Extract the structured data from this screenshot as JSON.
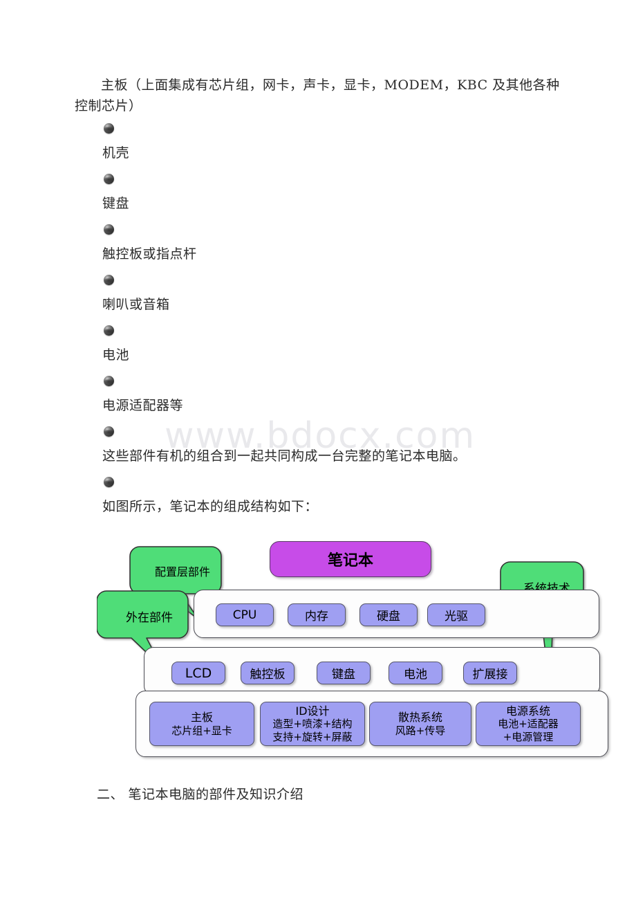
{
  "watermark": "www.bdocx.com",
  "document": {
    "intro_paragraph": "主板（上面集成有芯片组，网卡，声卡，显卡，MODEM，KBC 及其他各种控制芯片）",
    "bullet_items": [
      "机壳",
      "键盘",
      "触控板或指点杆",
      "喇叭或音箱",
      "电池",
      "电源适配器等",
      "这些部件有机的组合到一起共同构成一台完整的笔记本电脑。",
      "如图所示，笔记本的组成结构如下："
    ],
    "section_heading": "二、 笔记本电脑的部件及知识介绍"
  },
  "diagram": {
    "title_box": "笔记本",
    "callouts": [
      {
        "label": "配置层部件"
      },
      {
        "label": "外在部件"
      },
      {
        "label": "系统技术"
      }
    ],
    "rows": [
      {
        "name": "configuration-layer",
        "chips": [
          "CPU",
          "内存",
          "硬盘",
          "光驱"
        ]
      },
      {
        "name": "external-parts",
        "chips": [
          "LCD",
          "触控板",
          "键盘",
          "电池",
          "扩展接"
        ]
      }
    ],
    "system_row": [
      {
        "title": "主板",
        "lines": [
          "芯片组+显卡"
        ]
      },
      {
        "title": "ID设计",
        "lines": [
          "造型+喷漆+结构",
          "支持+旋转+屏蔽"
        ]
      },
      {
        "title": "散热系统",
        "lines": [
          "风路+传导"
        ]
      },
      {
        "title": "电源系统",
        "lines": [
          "电池+适配器",
          "+电源管理"
        ]
      }
    ]
  },
  "colors": {
    "title_purple": "#c74ce8",
    "chip_periwinkle": "#9f9ff2",
    "callout_green": "#4fdd78",
    "border_dark": "#4a4a52",
    "watermark_grey": "#e9e9ec"
  }
}
